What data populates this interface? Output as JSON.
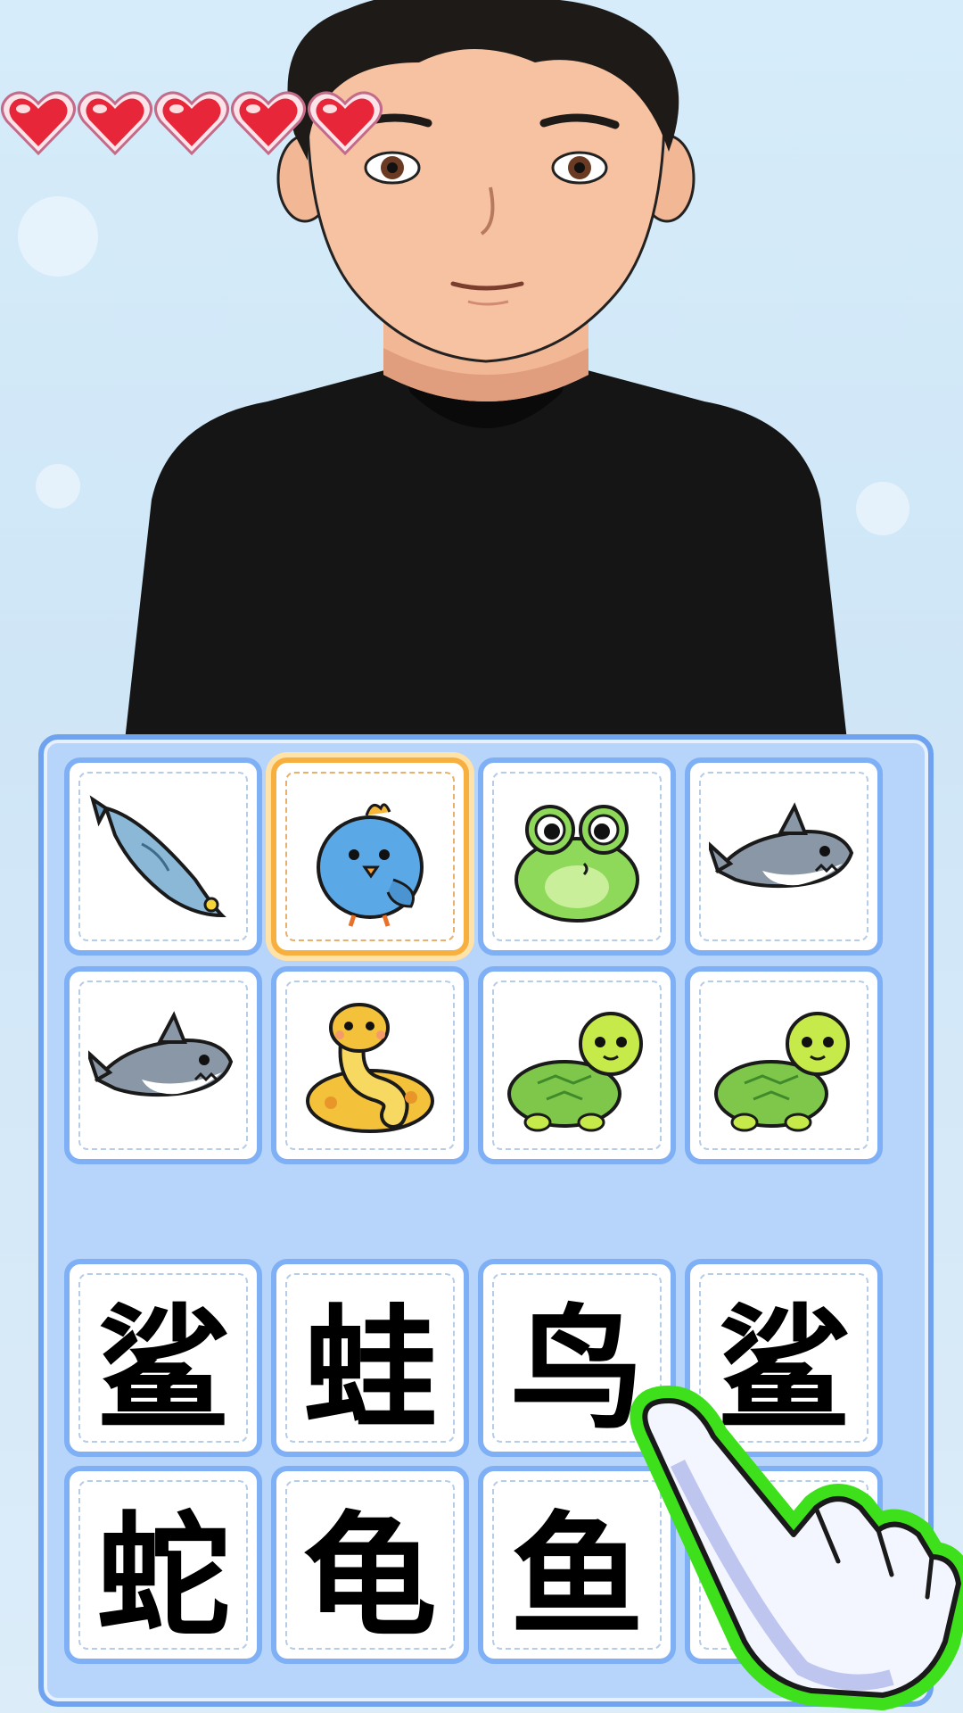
{
  "game": {
    "lives": 5,
    "picture_cards": [
      {
        "animal": "fish",
        "icon": "fish-icon",
        "selected": false
      },
      {
        "animal": "bird",
        "icon": "bird-icon",
        "selected": true
      },
      {
        "animal": "frog",
        "icon": "frog-icon",
        "selected": false
      },
      {
        "animal": "shark",
        "icon": "shark-icon",
        "selected": false
      },
      {
        "animal": "shark",
        "icon": "shark-icon",
        "selected": false
      },
      {
        "animal": "snake",
        "icon": "snake-icon",
        "selected": false
      },
      {
        "animal": "turtle",
        "icon": "turtle-icon",
        "selected": false
      },
      {
        "animal": "turtle",
        "icon": "turtle-icon",
        "selected": false
      }
    ],
    "word_cards": [
      "鲨",
      "蛙",
      "鸟",
      "鲨",
      "蛇",
      "龟",
      "鱼",
      ""
    ],
    "colors": {
      "board_bg": "#b7d4fb",
      "board_border": "#6fa3f0",
      "card_border": "#7fb0f5",
      "selected_border": "#f7b040",
      "heart": "#e8263a",
      "hint_glow": "#3de01a"
    }
  }
}
